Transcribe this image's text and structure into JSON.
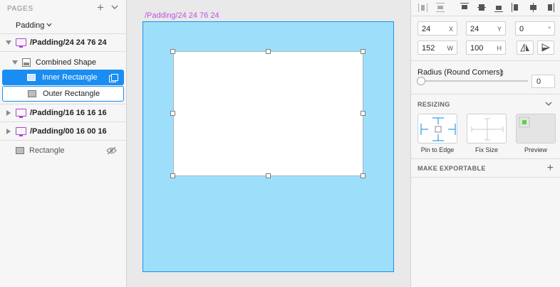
{
  "layers_panel": {
    "pages_label": "PAGES",
    "current_page": "Padding",
    "layers": [
      {
        "label": "/Padding/24 24 76 24"
      },
      {
        "label": "Combined Shape"
      },
      {
        "label": "Inner Rectangle"
      },
      {
        "label": "Outer Rectangle"
      },
      {
        "label": "/Padding/16 16 16 16"
      },
      {
        "label": "/Padding/00 16 00 16"
      },
      {
        "label": "Rectangle"
      }
    ]
  },
  "canvas": {
    "artboard_name": "/Padding/24 24 76 24",
    "artboard_color": "#9ddffa",
    "selection_color": "#1a8df2"
  },
  "inspector": {
    "position": {
      "x": "24",
      "x_unit": "X",
      "y": "24",
      "y_unit": "Y",
      "rotation": "0",
      "rotation_unit": "°"
    },
    "size": {
      "w": "152",
      "w_unit": "W",
      "h": "100",
      "h_unit": "H"
    },
    "radius_label": "Radius (Round Corners)",
    "radius_value": "0",
    "resizing_title": "RESIZING",
    "resizing_options": [
      {
        "label": "Pin to Edge"
      },
      {
        "label": "Fix Size"
      },
      {
        "label": "Preview"
      }
    ],
    "exportable_title": "MAKE EXPORTABLE",
    "accent_color": "#1a8df2",
    "preview_dot_color": "#5fd04a"
  }
}
